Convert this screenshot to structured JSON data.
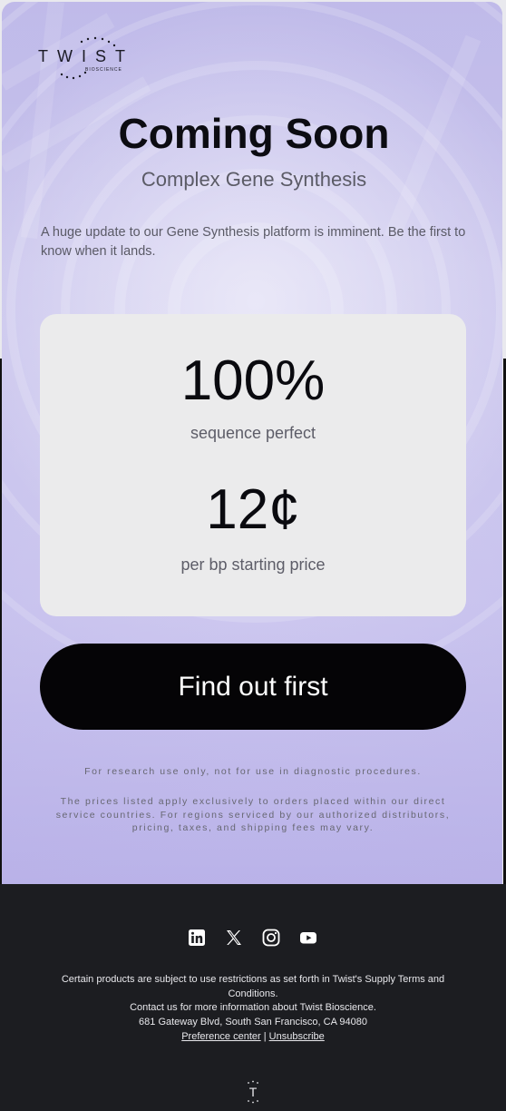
{
  "brand": {
    "logo_text": "TWIST",
    "logo_sub": "BIOSCIENCE"
  },
  "hero": {
    "title": "Coming Soon",
    "subtitle": "Complex Gene Synthesis",
    "intro": "A huge update to our Gene Synthesis platform is imminent. Be the first to know when it lands."
  },
  "stats": [
    {
      "value": "100%",
      "label": "sequence perfect"
    },
    {
      "value": "12¢",
      "label": "per bp starting price"
    }
  ],
  "cta": {
    "label": "Find out first"
  },
  "disclaimers": [
    "For research use only, not for use in diagnostic procedures.",
    "The prices listed apply exclusively to orders placed within our direct service countries. For regions serviced by our authorized distributors, pricing, taxes, and shipping fees may vary."
  ],
  "footer": {
    "social": [
      "linkedin-icon",
      "x-icon",
      "instagram-icon",
      "youtube-icon"
    ],
    "line1": "Certain products are subject to use restrictions as set forth in Twist's Supply Terms and Conditions.",
    "line2": "Contact us for more information about Twist Bioscience.",
    "address": "681 Gateway Blvd, South San Francisco, CA 94080",
    "preference_link": "Preference center",
    "separator": "|",
    "unsubscribe_link": "Unsubscribe",
    "logo_letter": "T"
  },
  "colors": {
    "cta_bg": "#050406",
    "footer_bg": "#1c1d21",
    "card_bg": "#ebebec"
  }
}
